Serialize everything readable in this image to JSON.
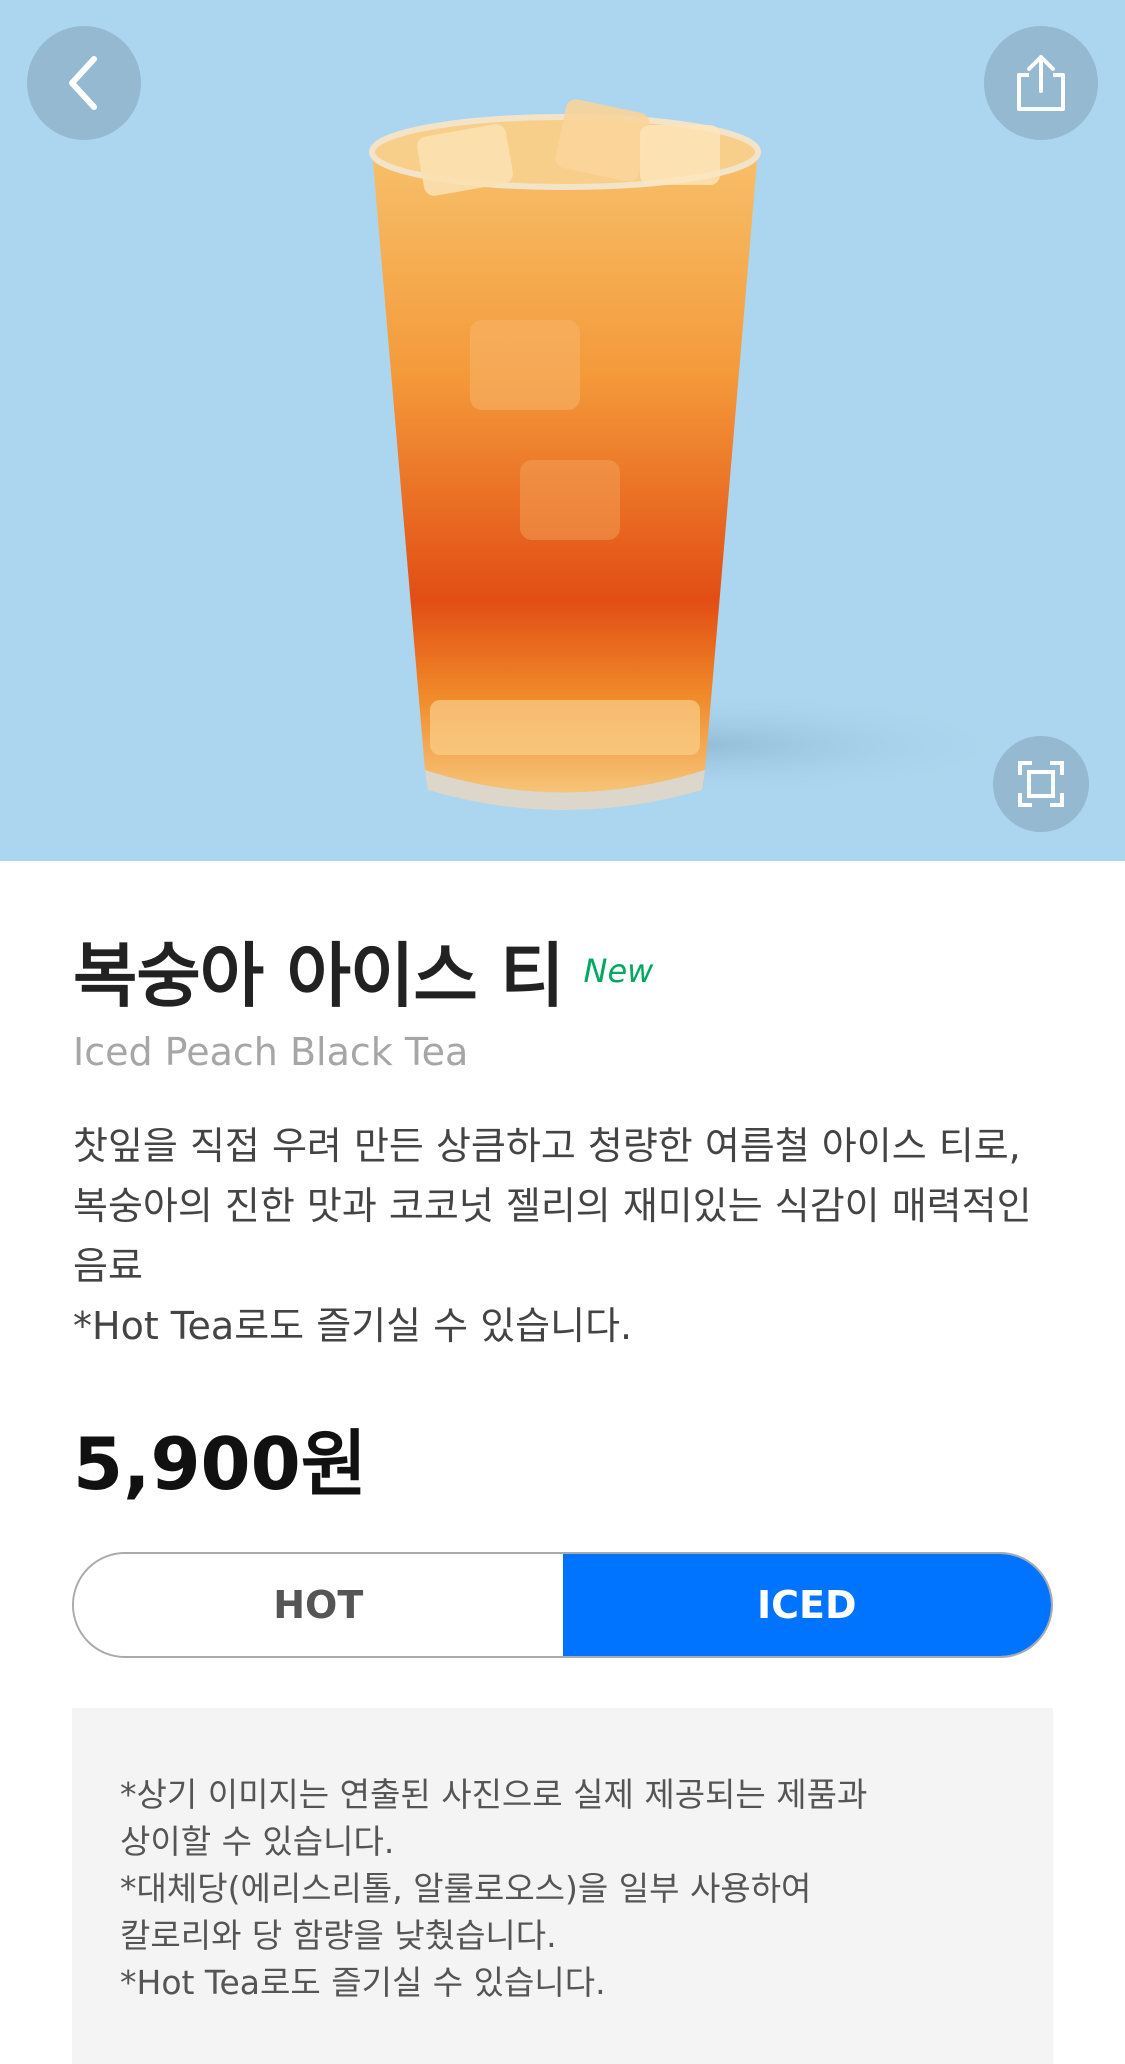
{
  "colors": {
    "hero_bg": "#acd6ef",
    "accent_blue": "#0074ff",
    "new_green": "#00a862",
    "notice_bg": "#f4f4f4"
  },
  "header": {
    "back_icon": "chevron-left-icon",
    "share_icon": "share-icon",
    "expand_icon": "expand-icon"
  },
  "product": {
    "name_ko": "복숭아 아이스 티",
    "badge": "New",
    "name_en": "Iced Peach Black Tea",
    "description": [
      "찻잎을 직접 우려 만든 상큼하고 청량한 여름철 아이스 티로,",
      "복숭아의 진한 맛과 코코넛 젤리의 재미있는 식감이 매력적인",
      "음료",
      "*Hot Tea로도 즐기실 수 있습니다."
    ],
    "price": "5,900원"
  },
  "temperature": {
    "options": [
      "HOT",
      "ICED"
    ],
    "selected": "ICED"
  },
  "notice": {
    "lines": [
      "*상기 이미지는 연출된 사진으로 실제 제공되는 제품과",
      "상이할 수 있습니다.",
      "*대체당(에리스리톨, 알룰로오스)을 일부 사용하여",
      "칼로리와 당 함량을 낮췄습니다.",
      "*Hot Tea로도 즐기실 수 있습니다."
    ]
  }
}
